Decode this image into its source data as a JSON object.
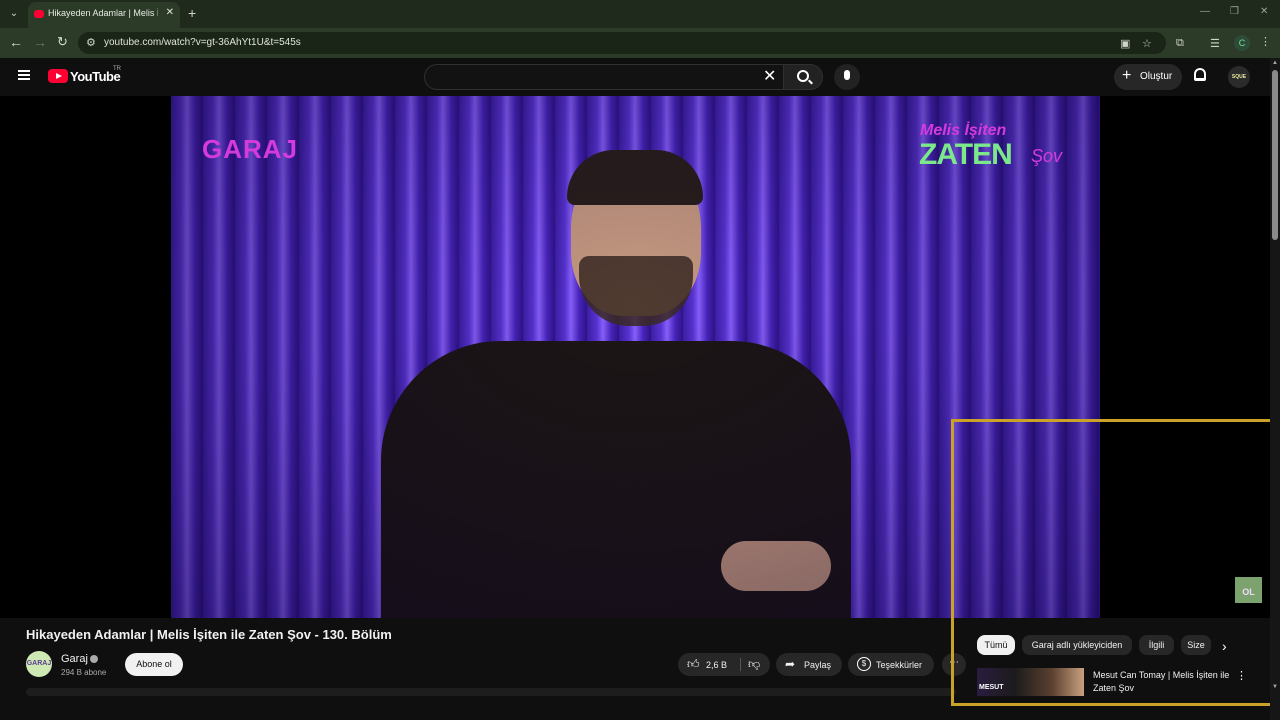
{
  "browser": {
    "tab_title": "Hikayeden Adamlar | Melis İşiten ile Zaten Şov - 130. Bölüm - YouTube",
    "url": "youtube.com/watch?v=gt-36AhYt1U&t=545s",
    "profile_letter": "C"
  },
  "header": {
    "logo_text": "YouTube",
    "country_code": "TR",
    "create_label": "Oluştur",
    "avatar_text": "SQUE"
  },
  "video_overlay": {
    "channel_logo": "GARAJ",
    "show_logo_top": "Melis İşiten",
    "show_logo_main": "ZATEN",
    "show_logo_suffix": "Şov",
    "subscribe_badge": "OL"
  },
  "video": {
    "title": "Hikayeden Adamlar | Melis İşiten ile Zaten Şov - 130. Bölüm",
    "channel_name": "Garaj",
    "channel_avatar_text": "GARAJ",
    "subscribers": "294 B abone",
    "subscribe_label": "Abone ol",
    "like_count": "2,6 B",
    "share_label": "Paylaş",
    "thanks_label": "Teşekkürler"
  },
  "chips": [
    "Tümü",
    "Garaj adlı yükleyiciden",
    "İlgili",
    "Size"
  ],
  "related": {
    "title": "Mesut Can Tomay | Melis İşiten ile Zaten Şov",
    "thumb_label": "MESUT"
  },
  "colors": {
    "youtube_red": "#ff0033",
    "highlight_frame": "#c9a227",
    "garaj_magenta": "#d63adf",
    "zaten_green": "#7be88a"
  }
}
